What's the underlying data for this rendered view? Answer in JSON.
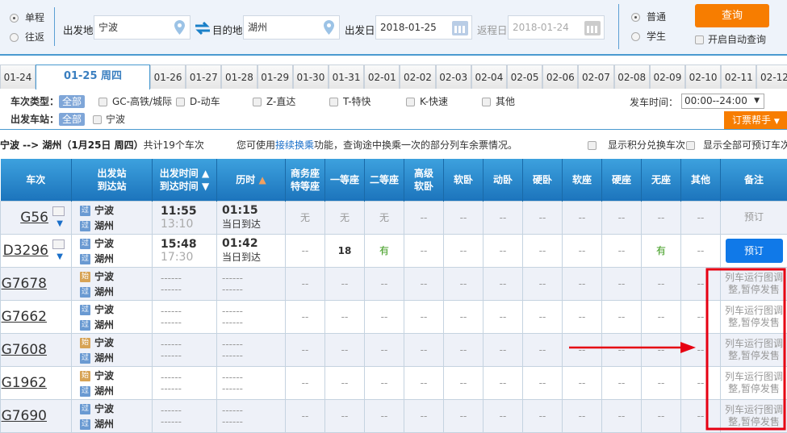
{
  "search": {
    "trip_types": [
      "单程",
      "往返"
    ],
    "from_label": "出发地",
    "from_value": "宁波",
    "to_label": "目的地",
    "to_value": "湖州",
    "depart_label": "出发日",
    "depart_value": "2018-01-25",
    "return_label": "返程日",
    "return_value": "2018-01-24",
    "passenger_types": [
      "普通",
      "学生"
    ],
    "query_button": "查询",
    "auto_query_label": "开启自动查询"
  },
  "dates": [
    "01-24",
    "01-25 周四",
    "01-26",
    "01-27",
    "01-28",
    "01-29",
    "01-30",
    "01-31",
    "02-01",
    "02-02",
    "02-03",
    "02-04",
    "02-05",
    "02-06",
    "02-07",
    "02-08",
    "02-09",
    "02-10",
    "02-11",
    "02-12"
  ],
  "filters": {
    "type_label": "车次类型：",
    "station_label": "出发车站：",
    "all": "全部",
    "types": [
      "GC-高铁/城际",
      "D-动车",
      "Z-直达",
      "T-特快",
      "K-快速",
      "其他"
    ],
    "stations": [
      "宁波"
    ],
    "time_label": "发车时间：",
    "time_value": "00:00--24:00",
    "helper": "订票帮手"
  },
  "summary": {
    "route": "宁波 --> 湖州（1月25日  周四）",
    "count": "共计19个车次",
    "tip_pre": "您可使用",
    "tip_link": "接续换乘",
    "tip_post": "功能，查询途中换乘一次的部分列车余票情况。",
    "opt1": "显示积分兑换车次",
    "opt2": "显示全部可预订车次"
  },
  "columns": [
    "车次",
    "出发站\n到达站",
    "出发时间\n到达时间",
    "历时",
    "商务座\n特等座",
    "一等座",
    "二等座",
    "高级\n软卧",
    "软卧",
    "动卧",
    "硬卧",
    "软座",
    "硬座",
    "无座",
    "其他",
    "备注"
  ],
  "trains": [
    {
      "no": "G56",
      "from_tag": "过",
      "from": "宁波",
      "to_tag": "过",
      "to": "湖州",
      "dep": "11:55",
      "arr": "13:10",
      "dur": "01:15",
      "dur_note": "当日到达",
      "seats": [
        "无",
        "无",
        "无",
        "--",
        "--",
        "--",
        "--",
        "--",
        "--",
        "--",
        "--"
      ],
      "note": "预订",
      "bookable": false
    },
    {
      "no": "D3296",
      "from_tag": "过",
      "from": "宁波",
      "to_tag": "过",
      "to": "湖州",
      "dep": "15:48",
      "arr": "17:30",
      "dur": "01:42",
      "dur_note": "当日到达",
      "seats": [
        "--",
        "18",
        "有",
        "--",
        "--",
        "--",
        "--",
        "--",
        "--",
        "有",
        "--"
      ],
      "note": "预订",
      "bookable": true
    },
    {
      "no": "G7678",
      "from_tag": "始",
      "from": "宁波",
      "to_tag": "过",
      "to": "湖州",
      "dep": "------",
      "arr": "------",
      "dur": "------",
      "dur_note": "------",
      "seats": [
        "--",
        "--",
        "--",
        "--",
        "--",
        "--",
        "--",
        "--",
        "--",
        "--",
        "--"
      ],
      "note": "列车运行图调整,暂停发售",
      "bookable": false
    },
    {
      "no": "G7662",
      "from_tag": "过",
      "from": "宁波",
      "to_tag": "过",
      "to": "湖州",
      "dep": "------",
      "arr": "------",
      "dur": "------",
      "dur_note": "------",
      "seats": [
        "--",
        "--",
        "--",
        "--",
        "--",
        "--",
        "--",
        "--",
        "--",
        "--",
        "--"
      ],
      "note": "列车运行图调整,暂停发售",
      "bookable": false
    },
    {
      "no": "G7608",
      "from_tag": "始",
      "from": "宁波",
      "to_tag": "过",
      "to": "湖州",
      "dep": "------",
      "arr": "------",
      "dur": "------",
      "dur_note": "------",
      "seats": [
        "--",
        "--",
        "--",
        "--",
        "--",
        "--",
        "--",
        "--",
        "--",
        "--",
        "--"
      ],
      "note": "列车运行图调整,暂停发售",
      "bookable": false
    },
    {
      "no": "G1962",
      "from_tag": "始",
      "from": "宁波",
      "to_tag": "过",
      "to": "湖州",
      "dep": "------",
      "arr": "------",
      "dur": "------",
      "dur_note": "------",
      "seats": [
        "--",
        "--",
        "--",
        "--",
        "--",
        "--",
        "--",
        "--",
        "--",
        "--",
        "--"
      ],
      "note": "列车运行图调整,暂停发售",
      "bookable": false
    },
    {
      "no": "G7690",
      "from_tag": "过",
      "from": "宁波",
      "to_tag": "过",
      "to": "湖州",
      "dep": "------",
      "arr": "------",
      "dur": "------",
      "dur_note": "------",
      "seats": [
        "--",
        "--",
        "--",
        "--",
        "--",
        "--",
        "--",
        "--",
        "--",
        "--",
        "--"
      ],
      "note": "列车运行图调整,暂停发售",
      "bookable": false
    }
  ],
  "colors": {
    "accent": "#1079e8",
    "header": "#2a88cc",
    "orange": "#f77d00",
    "annotation": "#e60012"
  }
}
